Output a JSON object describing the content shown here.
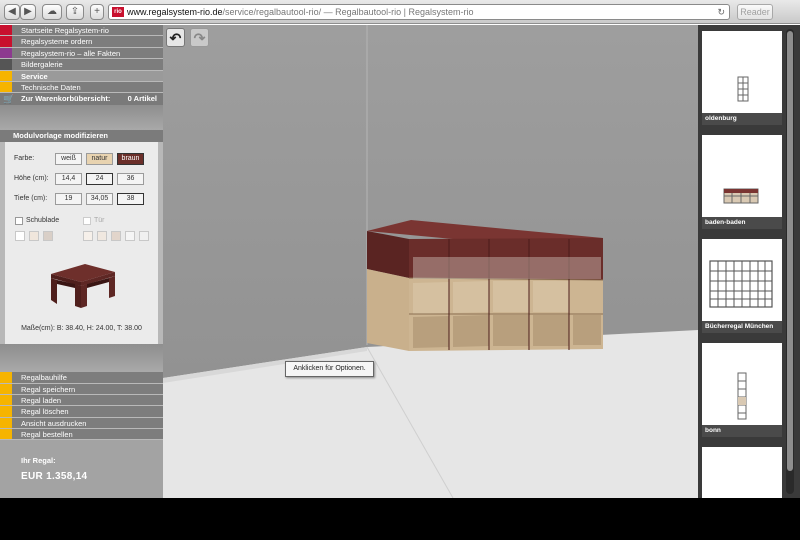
{
  "browser": {
    "address_host": "www.regalsystem-rio.de",
    "address_path": "/service/regalbautool-rio/",
    "address_title": " — Regalbautool-rio | Regalsystem-rio",
    "reader_label": "Reader"
  },
  "nav": {
    "items": [
      {
        "label": "Startseite Regalsystem-rio",
        "color": "#c8102e"
      },
      {
        "label": "Regalsysteme ordern",
        "color": "#c8102e"
      },
      {
        "label": "Regalsystem-rio – alle Fakten",
        "color": "#8d3a8f"
      },
      {
        "label": "Bildergalerie",
        "color": "#555555"
      },
      {
        "label": "Service",
        "color": "#f6b400"
      },
      {
        "label": "Technische Daten",
        "color": "#f6b400"
      }
    ],
    "cart_label": "Zur Warenkorbübersicht:",
    "cart_count": "0 Artikel"
  },
  "panel": {
    "title": "Modulvorlage modifizieren",
    "farbe_label": "Farbe:",
    "farbe_options": [
      "weiß",
      "natur",
      "braun"
    ],
    "hoehe_label": "Höhe (cm):",
    "hoehe_options": [
      "14,4",
      "24",
      "36"
    ],
    "tiefe_label": "Tiefe (cm):",
    "tiefe_options": [
      "19",
      "34,05",
      "38"
    ],
    "schublade_label": "Schublade",
    "tuer_label": "Tür",
    "dims": "Maße(cm): B: 38.40, H: 24.00, T: 38.00"
  },
  "actions": {
    "items": [
      "Regalbauhilfe",
      "Regal speichern",
      "Regal laden",
      "Regal löschen",
      "Ansicht ausdrucken",
      "Regal bestellen"
    ],
    "regal_title": "Ihr Regal:",
    "regal_price": "EUR 1.358,14"
  },
  "canvas": {
    "tooltip": "Anklicken für Optionen."
  },
  "rail": {
    "items": [
      "oldenburg",
      "baden-baden",
      "Bücherregal München",
      "bonn"
    ]
  },
  "colors": {
    "brown": "#6b2f2a",
    "natur": "#d8bf95",
    "accent_red": "#c8102e",
    "accent_yellow": "#f6b400"
  }
}
